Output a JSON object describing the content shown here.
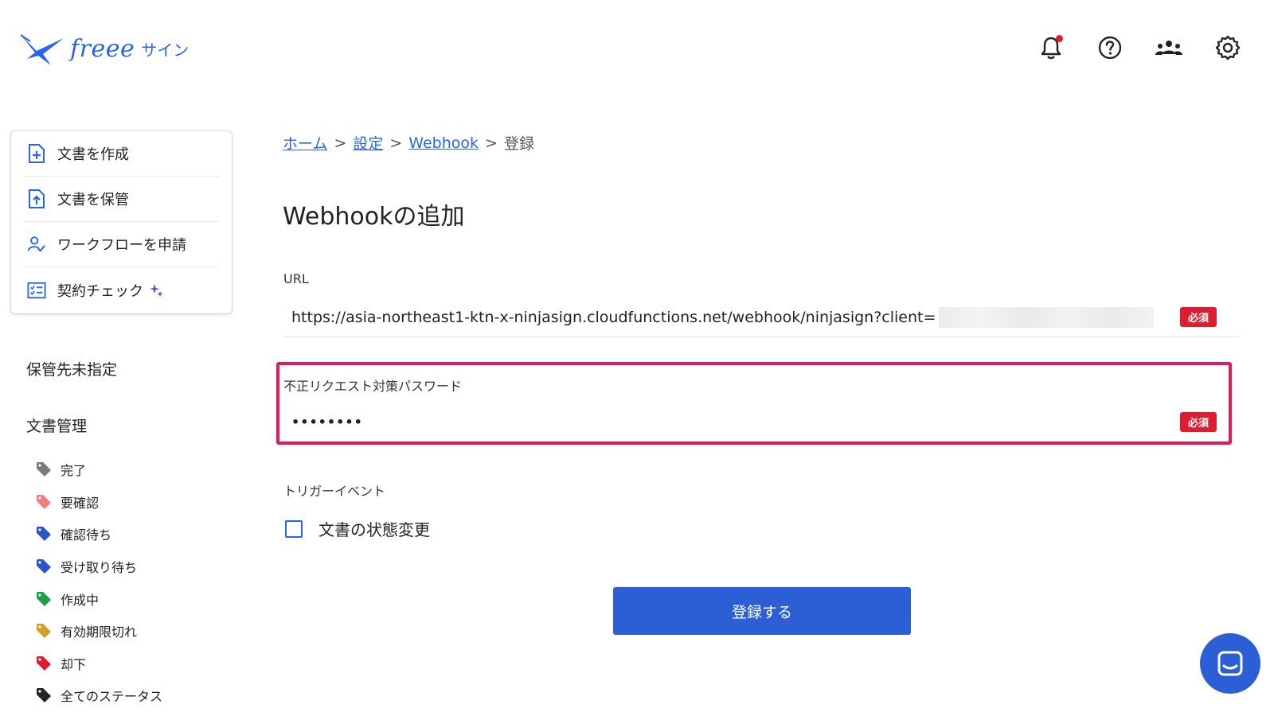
{
  "header": {
    "logo_text": "freee",
    "logo_sub": "サイン",
    "icons": [
      "bell-icon",
      "help-icon",
      "team-icon",
      "gear-icon"
    ],
    "accent_color": "#2864f0",
    "notification_color": "#dc1e32"
  },
  "sidebar": {
    "actions": [
      {
        "label": "文書を作成",
        "icon": "document-add-icon"
      },
      {
        "label": "文書を保管",
        "icon": "document-upload-icon"
      },
      {
        "label": "ワークフローを申請",
        "icon": "user-check-icon"
      },
      {
        "label": "契約チェック",
        "icon": "checklist-icon"
      }
    ],
    "section_unassigned": "保管先未指定",
    "section_docs": "文書管理",
    "tags": [
      {
        "label": "完了",
        "color": "#7a7a7a"
      },
      {
        "label": "要確認",
        "color": "#f08080"
      },
      {
        "label": "確認待ち",
        "color": "#2a55c8"
      },
      {
        "label": "受け取り待ち",
        "color": "#2a55c8"
      },
      {
        "label": "作成中",
        "color": "#1e9e4a"
      },
      {
        "label": "有効期限切れ",
        "color": "#d4a02a"
      },
      {
        "label": "却下",
        "color": "#dc1e32"
      },
      {
        "label": "全てのステータス",
        "color": "#222222"
      }
    ]
  },
  "breadcrumb": {
    "home": "ホーム",
    "settings": "設定",
    "webhook": "Webhook",
    "current": "登録",
    "separator": ">"
  },
  "main": {
    "title": "Webhookの追加",
    "url_label": "URL",
    "url_value": "https://asia-northeast1-ktn-x-ninjasign.cloudfunctions.net/webhook/ninjasign?client=",
    "required_label": "必須",
    "password_label": "不正リクエスト対策パスワード",
    "password_value": "••••••••",
    "trigger_label": "トリガーイベント",
    "checkbox_label": "文書の状態変更",
    "submit_label": "登録する"
  }
}
